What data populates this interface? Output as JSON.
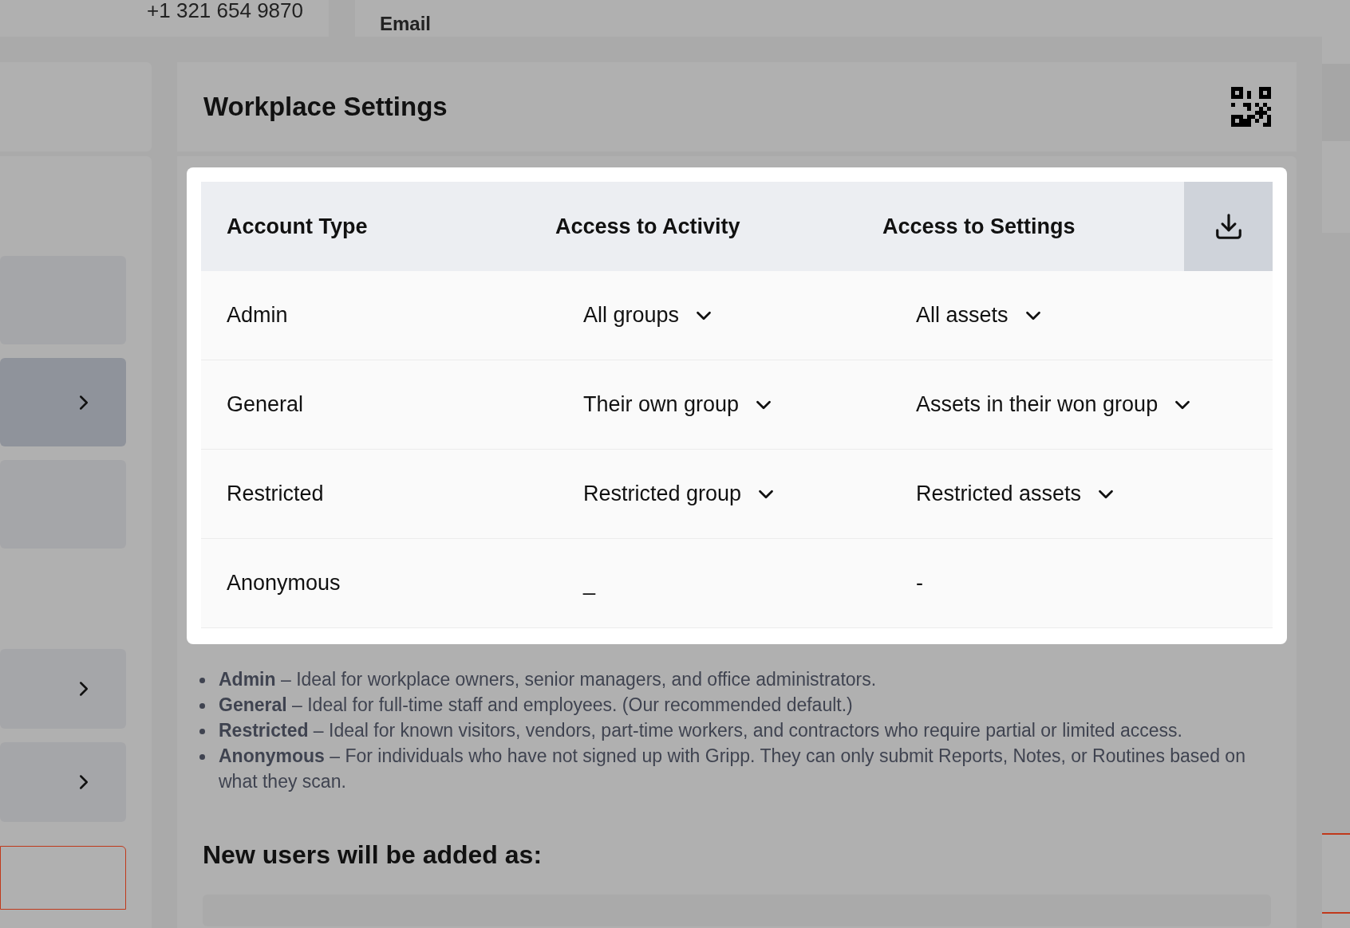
{
  "background": {
    "phone": "+1 321 654 9870",
    "email_label": "Email"
  },
  "sidebar": {
    "items": [
      {
        "kind": "blank",
        "selected": false
      },
      {
        "kind": "link",
        "selected": true
      },
      {
        "kind": "blank",
        "selected": false
      },
      {
        "kind": "link",
        "selected": false
      },
      {
        "kind": "link",
        "selected": false
      },
      {
        "kind": "outlined",
        "selected": false
      }
    ]
  },
  "panel": {
    "title": "Workplace Settings"
  },
  "table": {
    "columns": [
      "Account Type",
      "Access to Activity",
      "Access to Settings"
    ],
    "rows": [
      {
        "account_type": "Admin",
        "activity": {
          "kind": "dropdown",
          "value": "All groups"
        },
        "settings": {
          "kind": "dropdown",
          "value": "All assets"
        }
      },
      {
        "account_type": "General",
        "activity": {
          "kind": "dropdown",
          "value": "Their own group"
        },
        "settings": {
          "kind": "dropdown",
          "value": "Assets in their won group"
        }
      },
      {
        "account_type": "Restricted",
        "activity": {
          "kind": "dropdown",
          "value": "Restricted group"
        },
        "settings": {
          "kind": "dropdown",
          "value": "Restricted assets"
        }
      },
      {
        "account_type": "Anonymous",
        "activity": {
          "kind": "text",
          "value": "_"
        },
        "settings": {
          "kind": "text",
          "value": "-"
        }
      }
    ]
  },
  "legend": [
    "**Admin** – Ideal for workplace owners, senior managers, and office administrators.",
    "**General** – Ideal for full-time staff and employees. (Our recommended default.)",
    "**Restricted** – Ideal for known visitors, vendors, part-time workers, and contractors who require partial or limited access.",
    "**Anonymous** – For individuals who have not signed up with Gripp. They can only submit Reports, Notes, or Routines based on what they scan."
  ],
  "new_users": {
    "heading": "New users will be added as:"
  }
}
